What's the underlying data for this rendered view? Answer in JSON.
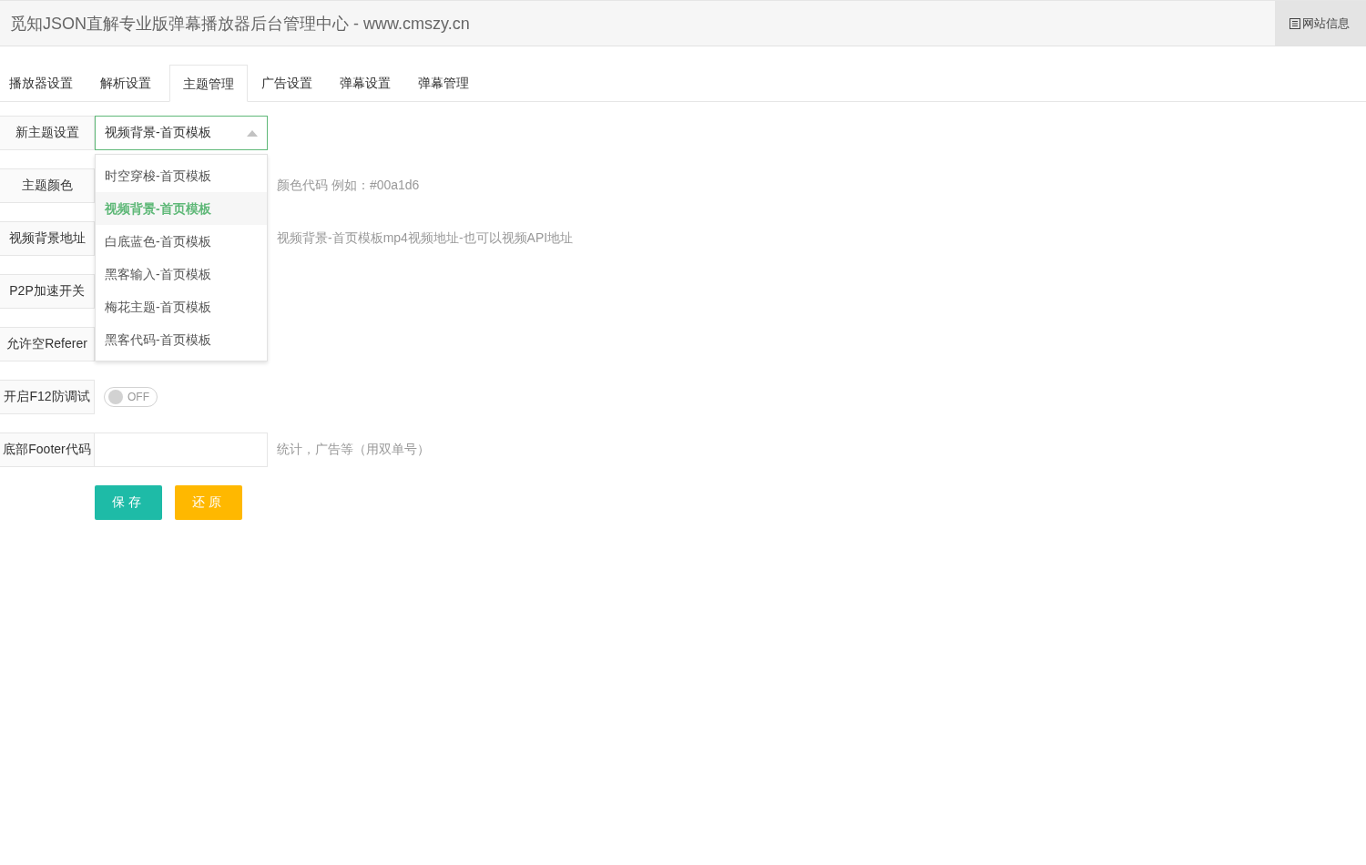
{
  "header": {
    "title": "觅知JSON直解专业版弹幕播放器后台管理中心 - www.cmszy.cn",
    "info_button": "网站信息"
  },
  "tabs": [
    {
      "label": "播放器设置",
      "selected": false
    },
    {
      "label": "解析设置",
      "selected": false
    },
    {
      "label": "主题管理",
      "selected": true
    },
    {
      "label": "广告设置",
      "selected": false
    },
    {
      "label": "弹幕设置",
      "selected": false
    },
    {
      "label": "弹幕管理",
      "selected": false
    }
  ],
  "form": {
    "rows": [
      {
        "label": "新主题设置",
        "kind": "select",
        "value": "视频背景-首页模板",
        "expanded": true,
        "options": [
          {
            "label": "时空穿梭-首页模板",
            "selected": false
          },
          {
            "label": "视频背景-首页模板",
            "selected": true
          },
          {
            "label": "白底蓝色-首页模板",
            "selected": false
          },
          {
            "label": "黑客输入-首页模板",
            "selected": false
          },
          {
            "label": "梅花主题-首页模板",
            "selected": false
          },
          {
            "label": "黑客代码-首页模板",
            "selected": false
          }
        ]
      },
      {
        "label": "主题颜色",
        "kind": "covered",
        "hint": "颜色代码 例如：#00a1d6"
      },
      {
        "label": "视频背景地址",
        "kind": "covered",
        "hint": "视频背景-首页模板mp4视频地址-也可以视频API地址"
      },
      {
        "label": "P2P加速开关",
        "kind": "covered"
      },
      {
        "label": "允许空Referer",
        "kind": "covered"
      },
      {
        "label": "开启F12防调试",
        "kind": "switch",
        "on": false,
        "text": "OFF"
      },
      {
        "label": "底部Footer代码",
        "kind": "text",
        "hint": "统计，广告等（用双单号）"
      }
    ]
  },
  "buttons": [
    {
      "label": "保存",
      "kind": "primary"
    },
    {
      "label": "还原",
      "kind": "warm"
    }
  ]
}
